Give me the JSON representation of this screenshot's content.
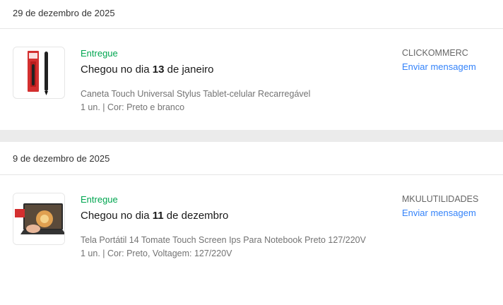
{
  "orders": [
    {
      "date": "29 de dezembro de 2025",
      "status": "Entregue",
      "headline_prefix": "Chegou no dia ",
      "headline_day": "13",
      "headline_suffix": " de janeiro",
      "title": "Caneta Touch Universal Stylus Tablet-celular Recarregável",
      "meta": "1 un. | Cor: Preto e branco",
      "seller": "CLICKOMMERC",
      "message_label": "Enviar mensagem",
      "thumb_icon": "stylus-pen-product-image"
    },
    {
      "date": "9 de dezembro de 2025",
      "status": "Entregue",
      "headline_prefix": "Chegou no dia ",
      "headline_day": "11",
      "headline_suffix": " de dezembro",
      "title": "Tela Portátil 14 Tomate Touch Screen Ips Para Notebook Preto 127/220V",
      "meta": "1 un. | Cor: Preto, Voltagem: 127/220V",
      "seller": "MKULUTILIDADES",
      "message_label": "Enviar mensagem",
      "thumb_icon": "portable-monitor-product-image"
    }
  ],
  "colors": {
    "success": "#00a650",
    "link": "#3483fa",
    "background": "#ebebeb"
  }
}
